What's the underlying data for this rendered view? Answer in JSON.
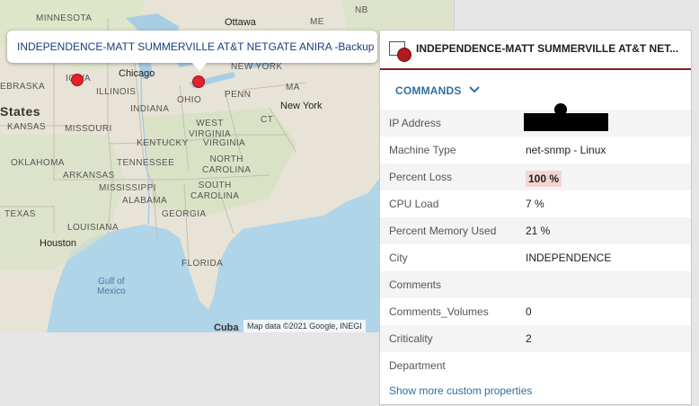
{
  "map": {
    "tooltip_text": "INDEPENDENCE-MATT SUMMERVILLE AT&T NETGATE ANIRA -Backup",
    "attribution": "Map data ©2021 Google, INEGI",
    "labels": {
      "minnesota": "MINNESOTA",
      "ottawa": "Ottawa",
      "nb": "NB",
      "me": "ME",
      "new_york_state": "NEW YORK",
      "nebraska": "EBRASKA",
      "iowa": "IOWA",
      "chicago": "Chicago",
      "illinois": "ILLINOIS",
      "ohio": "OHIO",
      "penn": "PENN",
      "ma": "MA",
      "states": "States",
      "indiana": "INDIANA",
      "kansas": "KANSAS",
      "missouri": "MISSOURI",
      "west_virginia": "WEST\nVIRGINIA",
      "ct": "CT",
      "new_york_city": "New York",
      "kentucky": "KENTUCKY",
      "virginia": "VIRGINIA",
      "oklahoma": "OKLAHOMA",
      "tennessee": "TENNESSEE",
      "north_carolina": "NORTH\nCAROLINA",
      "arkansas": "ARKANSAS",
      "mississippi": "MISSISSIPPI",
      "south_carolina": "SOUTH\nCAROLINA",
      "alabama": "ALABAMA",
      "texas": "TEXAS",
      "georgia": "GEORGIA",
      "louisiana": "LOUISIANA",
      "houston": "Houston",
      "florida": "FLORIDA",
      "gulf": "Gulf of\nMexico",
      "cuba": "Cuba"
    }
  },
  "panel": {
    "title": "INDEPENDENCE-MATT SUMMERVILLE AT&T NET...",
    "commands_label": "COMMANDS",
    "properties": [
      {
        "key": "IP Address",
        "value": ""
      },
      {
        "key": "Machine Type",
        "value": "net-snmp - Linux"
      },
      {
        "key": "Percent Loss",
        "value": "100 %"
      },
      {
        "key": "CPU Load",
        "value": "7 %"
      },
      {
        "key": "Percent Memory Used",
        "value": "21 %"
      },
      {
        "key": "City",
        "value": "INDEPENDENCE"
      },
      {
        "key": "Comments",
        "value": ""
      },
      {
        "key": "Comments_Volumes",
        "value": "0"
      },
      {
        "key": "Criticality",
        "value": "2"
      },
      {
        "key": "Department",
        "value": ""
      }
    ],
    "show_more": "Show more custom properties",
    "colors": {
      "accent": "#8b1e22",
      "link": "#2e6fa0",
      "loss_bg": "#f6d4d4",
      "loss_text": "#cc0000",
      "marker": "#e0242a"
    }
  }
}
